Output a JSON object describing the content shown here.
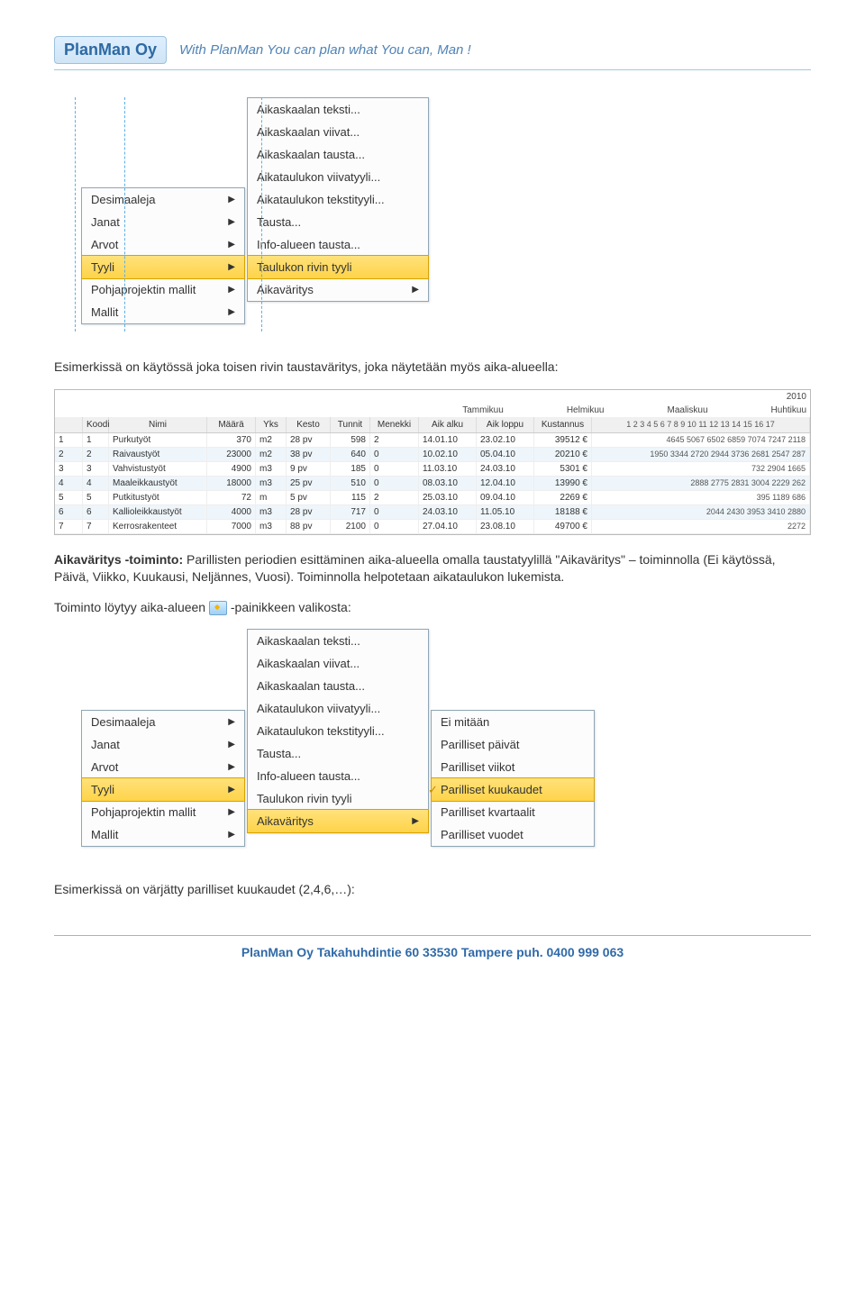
{
  "header": {
    "logo": "PlanMan Oy",
    "slogan": "With PlanMan You can plan what You can, Man !"
  },
  "menu1": {
    "left": [
      {
        "label": "Desimaaleja",
        "arrow": true
      },
      {
        "label": "Janat",
        "arrow": true
      },
      {
        "label": "Arvot",
        "arrow": true
      },
      {
        "label": "Tyyli",
        "arrow": true,
        "hi": true
      },
      {
        "label": "Pohjaprojektin mallit",
        "arrow": true
      },
      {
        "label": "Mallit",
        "arrow": true
      }
    ],
    "mid": [
      {
        "label": "Aikaskaalan teksti..."
      },
      {
        "label": "Aikaskaalan viivat..."
      },
      {
        "label": "Aikaskaalan tausta..."
      },
      {
        "label": "Aikataulukon viivatyyli..."
      },
      {
        "label": "Aikataulukon tekstityyli..."
      },
      {
        "label": "Tausta..."
      },
      {
        "label": "Info-alueen tausta..."
      },
      {
        "label": "Taulukon rivin tyyli",
        "hi": true
      },
      {
        "label": "Aikaväritys",
        "arrow": true
      }
    ]
  },
  "para1": "Esimerkissä on käytössä joka toisen rivin taustaväritys, joka näytetään myös aika-alueella:",
  "table": {
    "year": "2010",
    "months": [
      "Tammikuu",
      "Helmikuu",
      "Maaliskuu",
      "Huhtikuu"
    ],
    "nums": "1 2 3 4 5 6 7 8 9 10 11 12 13 14 15 16 17",
    "cols": [
      "",
      "Koodi",
      "Nimi",
      "Määrä",
      "Yks",
      "Kesto",
      "Tunnit",
      "Menekki",
      "Aik alku",
      "Aik loppu",
      "Kustannus"
    ],
    "rows": [
      {
        "idx": "1",
        "k": "1",
        "nimi": "Purkutyöt",
        "maara": "370",
        "yks": "m2",
        "kesto": "28 pv",
        "tun": "598",
        "men": "2",
        "a1": "14.01.10",
        "a2": "23.02.10",
        "kust": "39512 €",
        "ts": "4645 5067 6502 6859 7074 7247 2118"
      },
      {
        "idx": "2",
        "k": "2",
        "nimi": "Raivaustyöt",
        "maara": "23000",
        "yks": "m2",
        "kesto": "38 pv",
        "tun": "640",
        "men": "0",
        "a1": "10.02.10",
        "a2": "05.04.10",
        "kust": "20210 €",
        "ts": "1950 3344 2720 2944 3736 2681 2547 287"
      },
      {
        "idx": "3",
        "k": "3",
        "nimi": "Vahvistustyöt",
        "maara": "4900",
        "yks": "m3",
        "kesto": "9 pv",
        "tun": "185",
        "men": "0",
        "a1": "11.03.10",
        "a2": "24.03.10",
        "kust": "5301 €",
        "ts": "732 2904 1665"
      },
      {
        "idx": "4",
        "k": "4",
        "nimi": "Maaleikkaustyöt",
        "maara": "18000",
        "yks": "m3",
        "kesto": "25 pv",
        "tun": "510",
        "men": "0",
        "a1": "08.03.10",
        "a2": "12.04.10",
        "kust": "13990 €",
        "ts": "2888 2775 2831 3004 2229 262"
      },
      {
        "idx": "5",
        "k": "5",
        "nimi": "Putkitustyöt",
        "maara": "72",
        "yks": "m",
        "kesto": "5 pv",
        "tun": "115",
        "men": "2",
        "a1": "25.03.10",
        "a2": "09.04.10",
        "kust": "2269 €",
        "ts": "395 1189 686"
      },
      {
        "idx": "6",
        "k": "6",
        "nimi": "Kallioleikkaustyöt",
        "maara": "4000",
        "yks": "m3",
        "kesto": "28 pv",
        "tun": "717",
        "men": "0",
        "a1": "24.03.10",
        "a2": "11.05.10",
        "kust": "18188 €",
        "ts": "2044 2430      3953 3410 2880"
      },
      {
        "idx": "7",
        "k": "7",
        "nimi": "Kerrosrakenteet",
        "maara": "7000",
        "yks": "m3",
        "kesto": "88 pv",
        "tun": "2100",
        "men": "0",
        "a1": "27.04.10",
        "a2": "23.08.10",
        "kust": "49700 €",
        "ts": "2272"
      }
    ]
  },
  "para2": {
    "lead": "Aikaväritys -toiminto:",
    "body": " Parillisten periodien esittäminen aika-alueella omalla taustatyylillä \"Aikaväritys\" – toiminnolla (Ei käytössä, Päivä, Viikko, Kuukausi, Neljännes, Vuosi). Toiminnolla helpotetaan aikataulukon lukemista."
  },
  "para3_a": "Toiminto löytyy aika-alueen",
  "para3_b": "-painikkeen valikosta:",
  "menu2": {
    "left": [
      {
        "label": "Desimaaleja",
        "arrow": true
      },
      {
        "label": "Janat",
        "arrow": true
      },
      {
        "label": "Arvot",
        "arrow": true
      },
      {
        "label": "Tyyli",
        "arrow": true,
        "hi": true
      },
      {
        "label": "Pohjaprojektin mallit",
        "arrow": true
      },
      {
        "label": "Mallit",
        "arrow": true
      }
    ],
    "mid": [
      {
        "label": "Aikaskaalan teksti..."
      },
      {
        "label": "Aikaskaalan viivat..."
      },
      {
        "label": "Aikaskaalan tausta..."
      },
      {
        "label": "Aikataulukon viivatyyli..."
      },
      {
        "label": "Aikataulukon tekstityyli..."
      },
      {
        "label": "Tausta..."
      },
      {
        "label": "Info-alueen tausta..."
      },
      {
        "label": "Taulukon rivin tyyli"
      },
      {
        "label": "Aikaväritys",
        "arrow": true,
        "hi": true
      }
    ],
    "right": [
      {
        "label": "Ei mitään"
      },
      {
        "label": "Parilliset päivät"
      },
      {
        "label": "Parilliset viikot"
      },
      {
        "label": "Parilliset kuukaudet",
        "hi": true,
        "check": true
      },
      {
        "label": "Parilliset kvartaalit"
      },
      {
        "label": "Parilliset vuodet"
      }
    ]
  },
  "para4": "Esimerkissä on värjätty parilliset kuukaudet (2,4,6,…):",
  "footer": "PlanMan Oy   Takahuhdintie 60   33530 Tampere   puh. 0400 999 063"
}
